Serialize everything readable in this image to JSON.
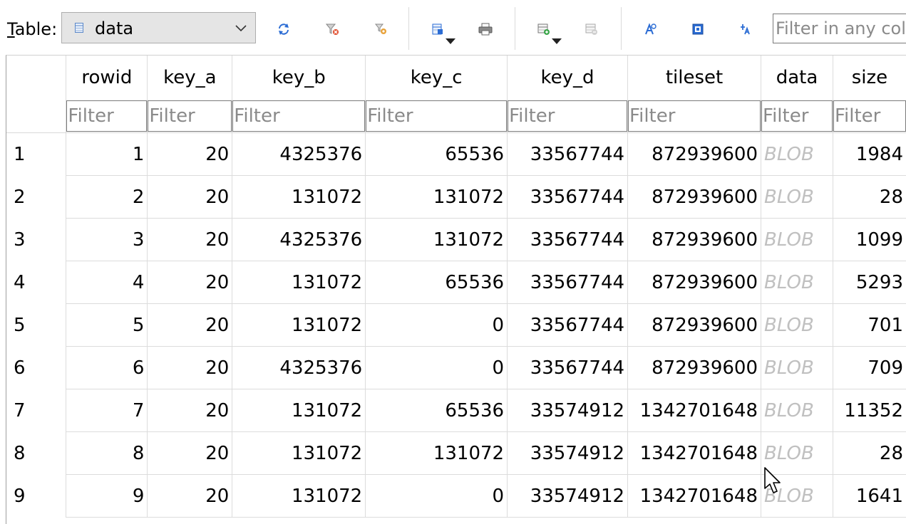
{
  "toolbar": {
    "table_label_mnemonic": "T",
    "table_label_rest": "able:",
    "table_selected": "data",
    "filter_all_placeholder": "Filter in any column"
  },
  "icons": {
    "table_icon": "table-icon",
    "refresh": "refresh-icon",
    "clear_filters": "clear-filters-icon",
    "save_filter": "save-filter-icon",
    "export": "export-icon",
    "print": "print-icon",
    "insert_record": "insert-record-icon",
    "delete_record": "delete-record-icon",
    "find": "find-icon",
    "find_replace": "find-replace-icon",
    "goto": "goto-icon"
  },
  "colors": {
    "blob_text": "#c0c0c0",
    "accent_blue": "#2b6cd4"
  },
  "grid": {
    "columns": [
      "rowid",
      "key_a",
      "key_b",
      "key_c",
      "key_d",
      "tileset",
      "data",
      "size"
    ],
    "filter_placeholder": "Filter",
    "rows": [
      {
        "num": "1",
        "cells": [
          "1",
          "20",
          "4325376",
          "65536",
          "33567744",
          "872939600",
          "BLOB",
          "1984"
        ]
      },
      {
        "num": "2",
        "cells": [
          "2",
          "20",
          "131072",
          "131072",
          "33567744",
          "872939600",
          "BLOB",
          "28"
        ]
      },
      {
        "num": "3",
        "cells": [
          "3",
          "20",
          "4325376",
          "131072",
          "33567744",
          "872939600",
          "BLOB",
          "1099"
        ]
      },
      {
        "num": "4",
        "cells": [
          "4",
          "20",
          "131072",
          "65536",
          "33567744",
          "872939600",
          "BLOB",
          "5293"
        ]
      },
      {
        "num": "5",
        "cells": [
          "5",
          "20",
          "131072",
          "0",
          "33567744",
          "872939600",
          "BLOB",
          "701"
        ]
      },
      {
        "num": "6",
        "cells": [
          "6",
          "20",
          "4325376",
          "0",
          "33567744",
          "872939600",
          "BLOB",
          "709"
        ]
      },
      {
        "num": "7",
        "cells": [
          "7",
          "20",
          "131072",
          "65536",
          "33574912",
          "1342701648",
          "BLOB",
          "11352"
        ]
      },
      {
        "num": "8",
        "cells": [
          "8",
          "20",
          "131072",
          "131072",
          "33574912",
          "1342701648",
          "BLOB",
          "28"
        ]
      },
      {
        "num": "9",
        "cells": [
          "9",
          "20",
          "131072",
          "0",
          "33574912",
          "1342701648",
          "BLOB",
          "1641"
        ]
      }
    ]
  }
}
